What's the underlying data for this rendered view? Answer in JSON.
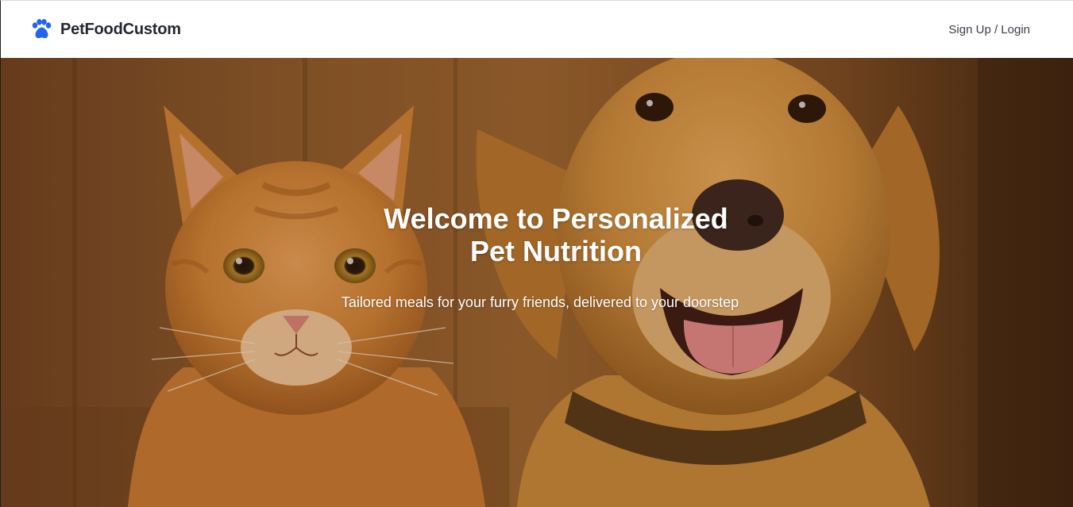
{
  "header": {
    "brand_name": "PetFoodCustom",
    "brand_icon": "paw-icon",
    "auth_link_label": "Sign Up / Login"
  },
  "hero": {
    "title_line1": "Welcome to Personalized",
    "title_line2": "Pet Nutrition",
    "subtitle": "Tailored meals for your furry friends, delivered to your doorstep",
    "image_subject": "orange tabby cat and golden retriever dog"
  },
  "colors": {
    "brand_icon": "#2563eb",
    "brand_text": "#222831",
    "link_text": "#3a3f47",
    "hero_text": "#ffffff"
  }
}
